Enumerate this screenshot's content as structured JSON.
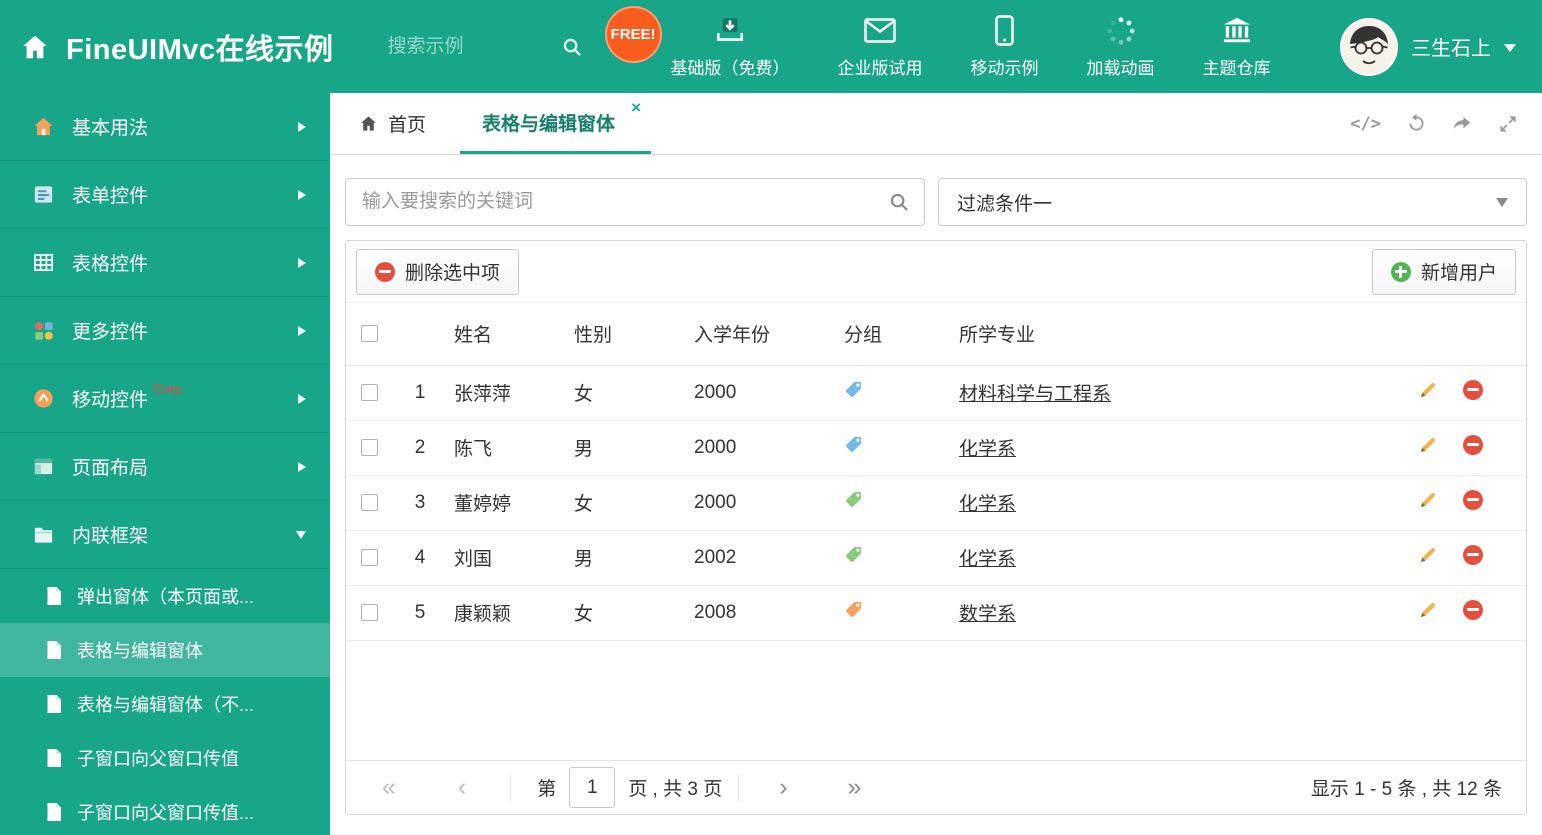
{
  "icons": {
    "code": "</>"
  },
  "header": {
    "title": "FineUIMvc在线示例",
    "search_placeholder": "搜索示例",
    "free_badge": "FREE!",
    "nav": [
      {
        "label": "基础版（免费）"
      },
      {
        "label": "企业版试用"
      },
      {
        "label": "移动示例"
      },
      {
        "label": "加载动画"
      },
      {
        "label": "主题仓库"
      }
    ],
    "username": "三生石上"
  },
  "sidebar": {
    "items": [
      {
        "label": "基本用法"
      },
      {
        "label": "表单控件"
      },
      {
        "label": "表格控件"
      },
      {
        "label": "更多控件"
      },
      {
        "label": "移动控件",
        "badge": "Corp."
      },
      {
        "label": "页面布局"
      },
      {
        "label": "内联框架"
      }
    ],
    "subitems": [
      {
        "label": "弹出窗体（本页面或..."
      },
      {
        "label": "表格与编辑窗体"
      },
      {
        "label": "表格与编辑窗体（不..."
      },
      {
        "label": "子窗口向父窗口传值"
      },
      {
        "label": "子窗口向父窗口传值..."
      }
    ]
  },
  "tabs": {
    "home": "首页",
    "active": "表格与编辑窗体",
    "close": "×"
  },
  "filter": {
    "search_placeholder": "输入要搜索的关键词",
    "dropdown_value": "过滤条件一"
  },
  "toolbar": {
    "delete": "删除选中项",
    "add": "新增用户"
  },
  "table": {
    "headers": {
      "name": "姓名",
      "gender": "性别",
      "year": "入学年份",
      "group": "分组",
      "major": "所学专业"
    },
    "rows": [
      {
        "num": "1",
        "name": "张萍萍",
        "gender": "女",
        "year": "2000",
        "tag_color": "#74b9e6",
        "major": "材料科学与工程系"
      },
      {
        "num": "2",
        "name": "陈飞",
        "gender": "男",
        "year": "2000",
        "tag_color": "#74b9e6",
        "major": "化学系"
      },
      {
        "num": "3",
        "name": "董婷婷",
        "gender": "女",
        "year": "2000",
        "tag_color": "#8bc97f",
        "major": "化学系"
      },
      {
        "num": "4",
        "name": "刘国",
        "gender": "男",
        "year": "2002",
        "tag_color": "#8bc97f",
        "major": "化学系"
      },
      {
        "num": "5",
        "name": "康颖颖",
        "gender": "女",
        "year": "2008",
        "tag_color": "#f2a35e",
        "major": "数学系"
      }
    ]
  },
  "pagination": {
    "first": "«",
    "prev": "‹",
    "prefix": "第",
    "page": "1",
    "suffix": "页 , 共 3 页",
    "next": "›",
    "last": "»",
    "summary": "显示 1 - 5 条 , 共 12 条"
  },
  "colors": {
    "theme_green": "#18a689",
    "active_tab_text": "#17806c",
    "danger_red": "#e3503e",
    "success_green": "#54b354",
    "pencil_orange": "#f0ad4e",
    "corp_red": "#ff3b30",
    "free_badge_orange": "#f95d1d"
  }
}
